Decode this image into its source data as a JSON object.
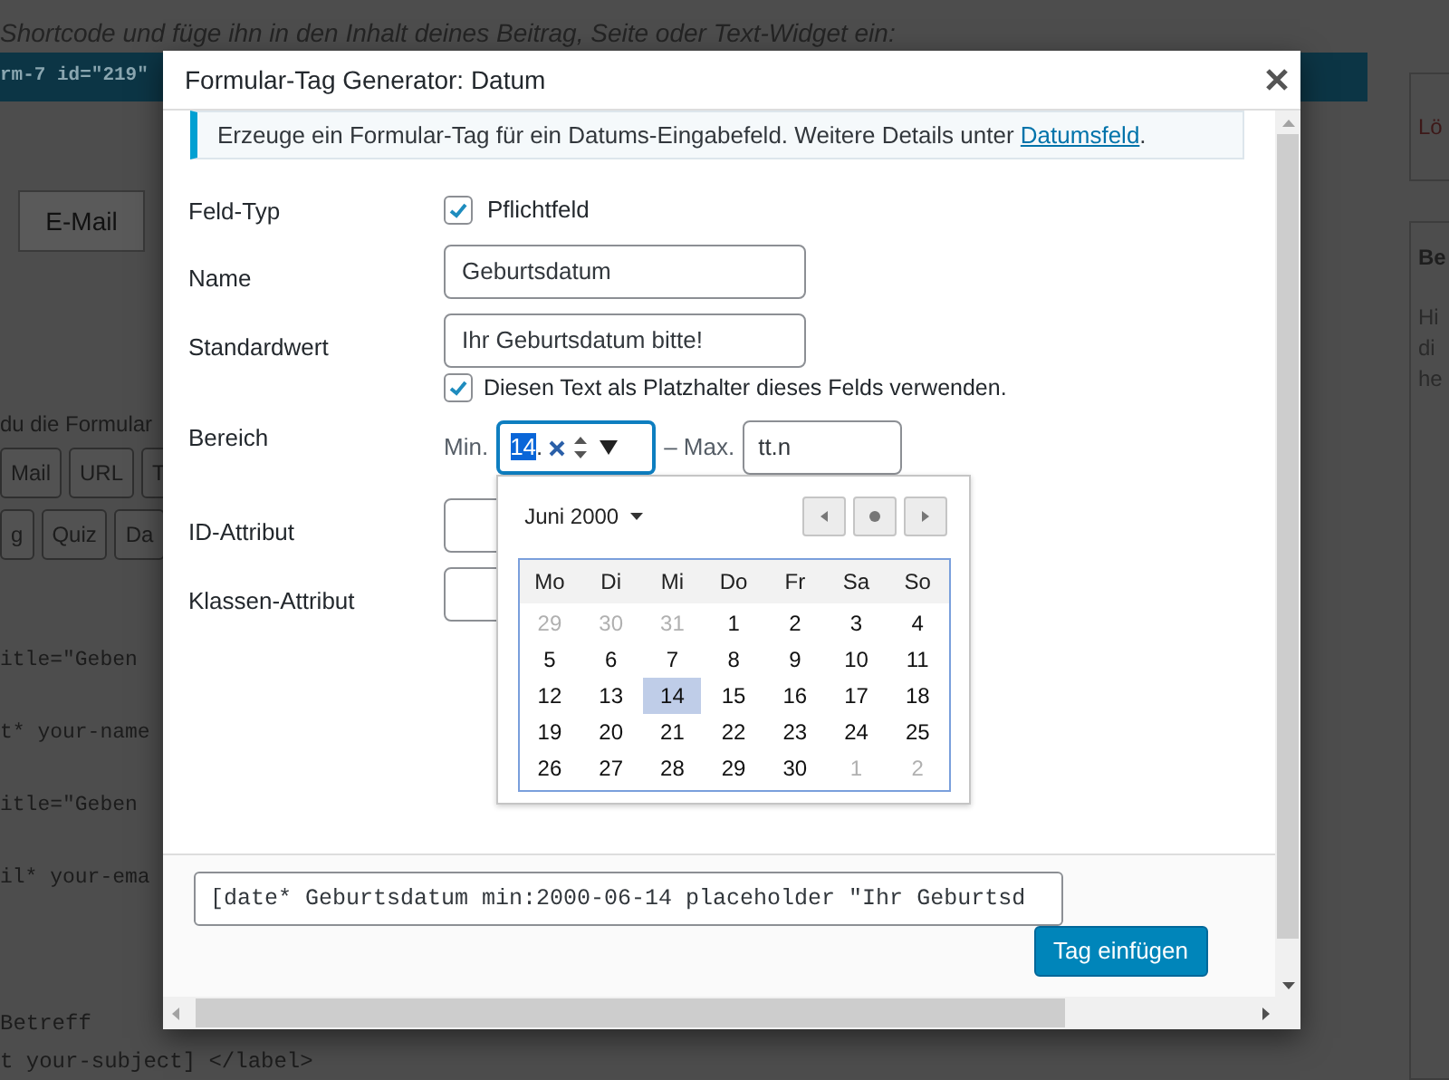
{
  "background": {
    "intro": "Shortcode und füge ihn in den Inhalt deines Beitrag, Seite oder Text-Widget ein:",
    "shortcode": "rm-7 id=\"219\"",
    "tab": "E-Mail",
    "hint": "du die Formular",
    "tag_rows": [
      [
        "Mail",
        "URL",
        "T"
      ],
      [
        "g",
        "Quiz",
        "Da"
      ]
    ],
    "code_top": [
      "itle=\"Geben",
      "t* your-name",
      "itle=\"Geben",
      "il* your-ema"
    ],
    "code_bottom": [
      "Betreff",
      "t your-subject] </label>"
    ],
    "sidebar": {
      "box_1": "Lö",
      "box_2_title": "Be",
      "box_2_lines": [
        "Hi",
        "di",
        "he"
      ]
    }
  },
  "dialog": {
    "title": "Formular-Tag Generator: Datum",
    "notice": {
      "text": "Erzeuge ein Formular-Tag für ein Datums-Eingabefeld. Weitere Details unter ",
      "link": "Datumsfeld",
      "after": "."
    },
    "fields": [
      {
        "kind": "checkbox",
        "label": "Feld-Typ",
        "option": "Pflichtfeld",
        "checked": true
      },
      {
        "kind": "text",
        "label": "Name",
        "value": "Geburtsdatum"
      },
      {
        "kind": "text_option",
        "label": "Standardwert",
        "value": "Ihr Geburtsdatum bitte!",
        "option": "Diesen Text als Platzhalter dieses Felds verwenden.",
        "checked": true
      },
      {
        "kind": "range",
        "label": "Bereich",
        "min_label": "Min.",
        "min_segment": "14",
        "min_rest": ".",
        "max_label": "– Max.",
        "max_value": "tt.n"
      },
      {
        "kind": "text",
        "label": "ID-Attribut"
      },
      {
        "kind": "text",
        "label": "Klassen-Attribut"
      }
    ],
    "datepicker": {
      "month": "Juni 2000",
      "weekdays": [
        "Mo",
        "Di",
        "Mi",
        "Do",
        "Fr",
        "Sa",
        "So"
      ],
      "weeks": [
        [
          {
            "day": "29",
            "muted": true,
            "selected": false
          },
          {
            "day": "30",
            "muted": true,
            "selected": false
          },
          {
            "day": "31",
            "muted": true,
            "selected": false
          },
          {
            "day": "1",
            "muted": false,
            "selected": false
          },
          {
            "day": "2",
            "muted": false,
            "selected": false
          },
          {
            "day": "3",
            "muted": false,
            "selected": false
          },
          {
            "day": "4",
            "muted": false,
            "selected": false
          }
        ],
        [
          {
            "day": "5",
            "muted": false,
            "selected": false
          },
          {
            "day": "6",
            "muted": false,
            "selected": false
          },
          {
            "day": "7",
            "muted": false,
            "selected": false
          },
          {
            "day": "8",
            "muted": false,
            "selected": false
          },
          {
            "day": "9",
            "muted": false,
            "selected": false
          },
          {
            "day": "10",
            "muted": false,
            "selected": false
          },
          {
            "day": "11",
            "muted": false,
            "selected": false
          }
        ],
        [
          {
            "day": "12",
            "muted": false,
            "selected": false
          },
          {
            "day": "13",
            "muted": false,
            "selected": false
          },
          {
            "day": "14",
            "muted": false,
            "selected": true
          },
          {
            "day": "15",
            "muted": false,
            "selected": false
          },
          {
            "day": "16",
            "muted": false,
            "selected": false
          },
          {
            "day": "17",
            "muted": false,
            "selected": false
          },
          {
            "day": "18",
            "muted": false,
            "selected": false
          }
        ],
        [
          {
            "day": "19",
            "muted": false,
            "selected": false
          },
          {
            "day": "20",
            "muted": false,
            "selected": false
          },
          {
            "day": "21",
            "muted": false,
            "selected": false
          },
          {
            "day": "22",
            "muted": false,
            "selected": false
          },
          {
            "day": "23",
            "muted": false,
            "selected": false
          },
          {
            "day": "24",
            "muted": false,
            "selected": false
          },
          {
            "day": "25",
            "muted": false,
            "selected": false
          }
        ],
        [
          {
            "day": "26",
            "muted": false,
            "selected": false
          },
          {
            "day": "27",
            "muted": false,
            "selected": false
          },
          {
            "day": "28",
            "muted": false,
            "selected": false
          },
          {
            "day": "29",
            "muted": false,
            "selected": false
          },
          {
            "day": "30",
            "muted": false,
            "selected": false
          },
          {
            "day": "1",
            "muted": true,
            "selected": false
          },
          {
            "day": "2",
            "muted": true,
            "selected": false
          }
        ]
      ]
    },
    "tag": "[date* Geburtsdatum min:2000-06-14 placeholder \"Ihr Geburtsd",
    "insert_button": "Tag einfügen"
  }
}
